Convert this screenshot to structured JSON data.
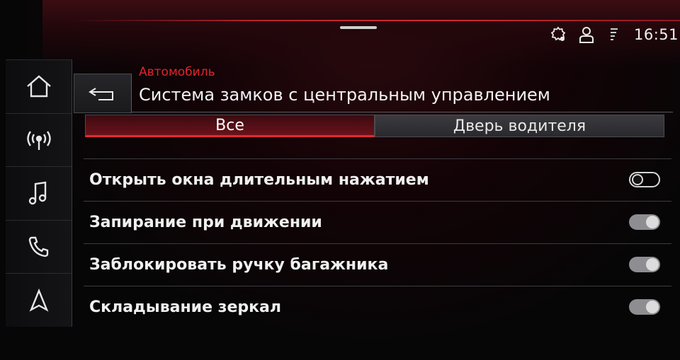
{
  "status_bar": {
    "time": "16:51",
    "icons": [
      "gear-location-icon",
      "user-profile-icon",
      "signal-strength-icon"
    ]
  },
  "sidebar": {
    "items": [
      {
        "icon": "home-icon"
      },
      {
        "icon": "radio-icon"
      },
      {
        "icon": "music-note-icon"
      },
      {
        "icon": "phone-icon"
      },
      {
        "icon": "navigation-icon"
      }
    ]
  },
  "header": {
    "breadcrumb": "Автомобиль",
    "title": "Система замков с центральным управлением",
    "back_icon": "back-arrow-icon"
  },
  "tabs": [
    {
      "label": "Все",
      "active": true
    },
    {
      "label": "Дверь водителя",
      "active": false
    }
  ],
  "settings": [
    {
      "label": "Открыть окна длительным нажатием",
      "enabled": false
    },
    {
      "label": "Запирание при движении",
      "enabled": true
    },
    {
      "label": "Заблокировать ручку багажника",
      "enabled": true
    },
    {
      "label": "Складывание зеркал",
      "enabled": true
    }
  ],
  "colors": {
    "accent_red": "#e0252f",
    "background": "#050506",
    "toggle_on": "#8d8d92"
  }
}
